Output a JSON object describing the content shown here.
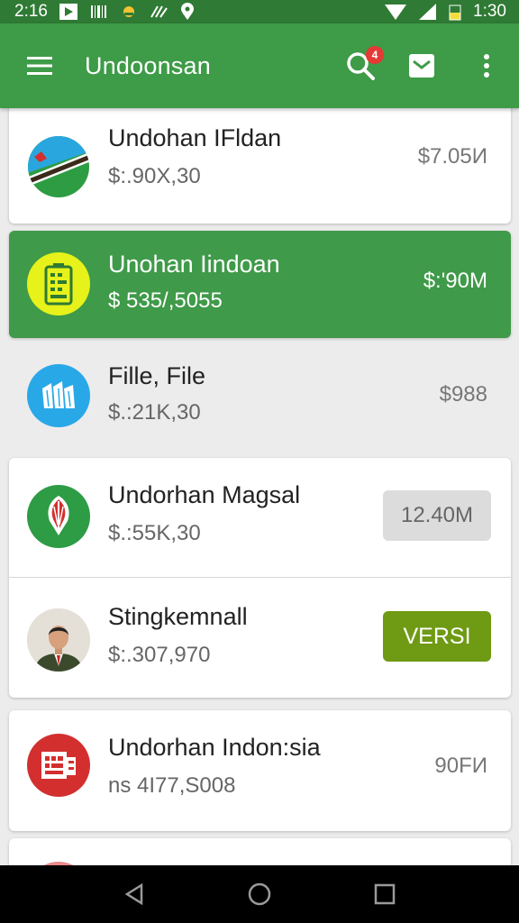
{
  "status_bar": {
    "time_left": "2:16",
    "time_right": "1:30"
  },
  "app_bar": {
    "title": "Undoonsan",
    "notification_count": "4"
  },
  "items": [
    {
      "title": "Undohan IFldan",
      "subtitle": "$:.90X,30",
      "value": "$7.05И",
      "icon": "flag-icon"
    },
    {
      "title": "Unohan Iindoan",
      "subtitle": "$ 535/,5055",
      "value": "$:'90M",
      "icon": "battery-icon"
    },
    {
      "title": "Fille, File",
      "subtitle": "$.:21K,30",
      "value": "$988",
      "icon": "files-icon"
    },
    {
      "title": "Undorhan Magsal",
      "subtitle": "$.:55K,30",
      "value": "12.40M",
      "icon": "emblem-icon"
    },
    {
      "title": "Stingkemnall",
      "subtitle": "$:.307,970",
      "value": "VERSI",
      "icon": "person-avatar"
    },
    {
      "title": "Undorhan Indon:sia",
      "subtitle": "ns 4I77,S008",
      "value": "90FИ",
      "icon": "document-icon"
    }
  ],
  "colors": {
    "primary": "#3e9b47",
    "status": "#2f7a34",
    "chip_green": "#6f9a14",
    "badge": "#e53935"
  }
}
